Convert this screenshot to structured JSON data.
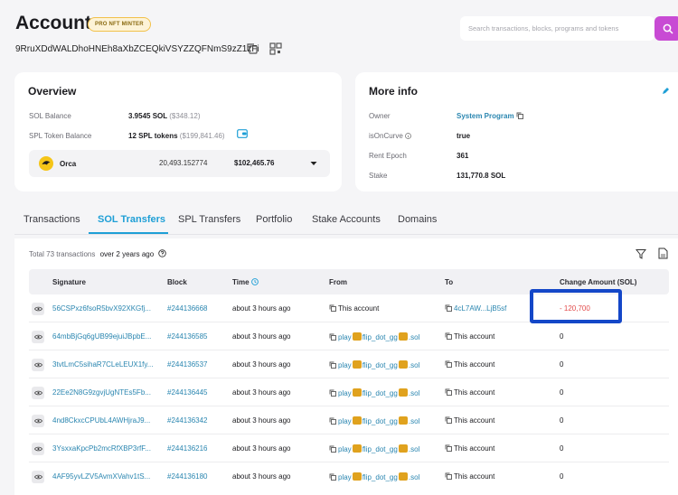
{
  "header": {
    "title": "Account",
    "badge": "PRO NFT MINTER",
    "address": "9RruXDdWALDhoHNEh8aXbZCEQkiVSYZZQFNmS9zZ1zFi",
    "search_placeholder": "Search transactions, blocks, programs and tokens"
  },
  "overview": {
    "title": "Overview",
    "sol_balance_label": "SOL Balance",
    "sol_balance_value": "3.9545 SOL",
    "sol_balance_usd": "($348.12)",
    "spl_label": "SPL Token Balance",
    "spl_value": "12 SPL tokens",
    "spl_usd": "($199,841.46)",
    "token": {
      "name": "Orca",
      "amount": "20,493.152774",
      "usd": "$102,465.76"
    }
  },
  "more_info": {
    "title": "More info",
    "owner_label": "Owner",
    "owner_value": "System Program",
    "curve_label": "isOnCurve",
    "curve_value": "true",
    "rent_label": "Rent Epoch",
    "rent_value": "361",
    "stake_label": "Stake",
    "stake_value": "131,770.8 SOL"
  },
  "tabs": [
    "Transactions",
    "SOL Transfers",
    "SPL Transfers",
    "Portfolio",
    "Stake Accounts",
    "Domains"
  ],
  "table": {
    "total": "Total 73 transactions",
    "age": "over 2 years ago",
    "columns": [
      "Signature",
      "Block",
      "Time",
      "From",
      "To",
      "Change Amount (SOL)"
    ],
    "rows": [
      {
        "sig": "56CSPxz6fsoR5bvX92XKGfj...",
        "block": "#244136668",
        "time": "about 3 hours ago",
        "from": "This account",
        "to": "4cL7AW...LjB5sf",
        "amount": "- 120,700"
      },
      {
        "sig": "64mbBjGq6gUB99ejuiJBpbE...",
        "block": "#244136585",
        "time": "about 3 hours ago",
        "from_a": "play",
        "from_b": "flip_dot_gg",
        "from_c": ".sol",
        "to": "This account",
        "amount": "0"
      },
      {
        "sig": "3tvtLmC5sihaR7CLeLEUX1fy...",
        "block": "#244136537",
        "time": "about 3 hours ago",
        "from_a": "play",
        "from_b": "flip_dot_gg",
        "from_c": ".sol",
        "to": "This account",
        "amount": "0"
      },
      {
        "sig": "22Ee2N8G9zgvjUgNTEs5Fb...",
        "block": "#244136445",
        "time": "about 3 hours ago",
        "from_a": "play",
        "from_b": "flip_dot_gg",
        "from_c": ".sol",
        "to": "This account",
        "amount": "0"
      },
      {
        "sig": "4nd8CkxcCPUbL4AWHjraJ9...",
        "block": "#244136342",
        "time": "about 3 hours ago",
        "from_a": "play",
        "from_b": "flip_dot_gg",
        "from_c": ".sol",
        "to": "This account",
        "amount": "0"
      },
      {
        "sig": "3YsxxaKpcPb2mcRfXBP3rfF...",
        "block": "#244136216",
        "time": "about 3 hours ago",
        "from_a": "play",
        "from_b": "flip_dot_gg",
        "from_c": ".sol",
        "to": "This account",
        "amount": "0"
      },
      {
        "sig": "4AF95yvLZV5AvmXVahv1tS...",
        "block": "#244136180",
        "time": "about 3 hours ago",
        "from_a": "play",
        "from_b": "flip_dot_gg",
        "from_c": ".sol",
        "to": "This account",
        "amount": "0"
      }
    ]
  }
}
